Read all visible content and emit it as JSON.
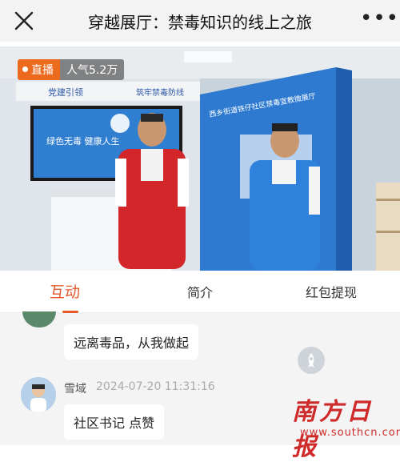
{
  "header": {
    "title": "穿越展厅：禁毒知识的线上之旅",
    "close_icon": "close-icon",
    "more_label": "•••"
  },
  "video": {
    "live_label": "直播",
    "popularity": "人气5.2万",
    "scene": {
      "screen_line1": "绿色无毒  健康人生",
      "banner_left": "党建引领",
      "banner_right": "筑牢禁毒防线",
      "wall_title": "西乡街道铁仔社区禁毒宣教微展厅"
    }
  },
  "tabs": [
    {
      "label": "互动",
      "active": true
    },
    {
      "label": "简介",
      "active": false
    },
    {
      "label": "红包提现",
      "active": false
    }
  ],
  "chat": {
    "messages": [
      {
        "text": "远离毒品，从我做起"
      },
      {
        "username": "雪域",
        "timestamp": "2024-07-20 11:31:16",
        "text": "社区书记 点赞"
      }
    ]
  },
  "watermark": {
    "title": "南方日报",
    "url": "www.southcn.com"
  },
  "colors": {
    "accent": "#e5592a",
    "live": "#ec6a1e",
    "watermark": "#cf2a2a"
  }
}
